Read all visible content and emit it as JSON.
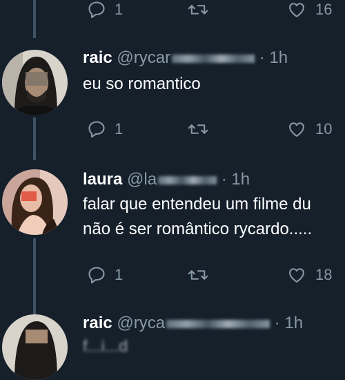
{
  "colors": {
    "background": "#15202b",
    "secondary_text": "#8899a6",
    "thread_line": "#3d5466"
  },
  "partial_top": {
    "reply_count": "1",
    "like_count": "16"
  },
  "tweets": [
    {
      "name": "raic",
      "handle": "@rycar",
      "time": "· 1h",
      "lines": [
        "eu so romantico"
      ],
      "reply_count": "1",
      "like_count": "10"
    },
    {
      "name": "laura",
      "handle": "@la",
      "time": "· 1h",
      "lines": [
        "falar que entendeu um filme du",
        "não é ser romântico rycardo....."
      ],
      "reply_count": "1",
      "like_count": "18"
    },
    {
      "name": "raic",
      "handle": "@ryca",
      "time": "· 1h",
      "lines": [
        "f...i...d"
      ]
    }
  ],
  "icons": {
    "reply": "reply-icon",
    "retweet": "retweet-icon",
    "like": "heart-icon"
  }
}
